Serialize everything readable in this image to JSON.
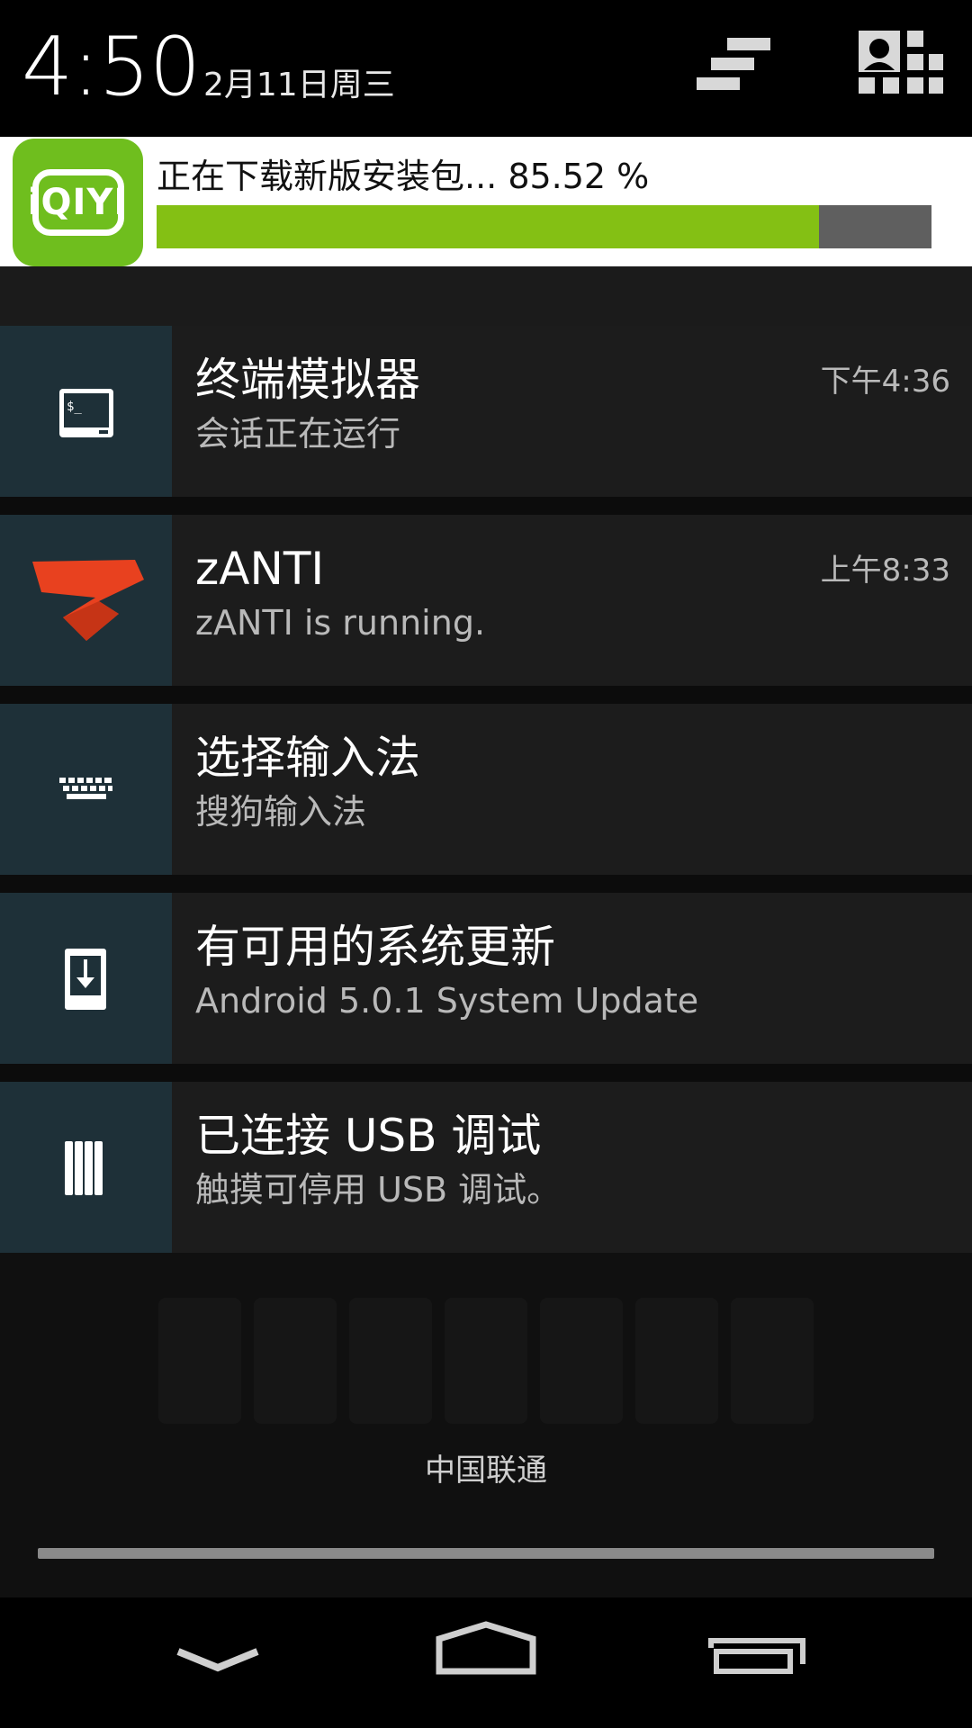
{
  "header": {
    "time": "4:50",
    "date": "2月11日周三"
  },
  "download": {
    "app_icon": "iqiyi-app-icon",
    "icon_text": "iQIYI",
    "text": "正在下载新版安装包... 85.52 %",
    "progress_percent": 85.52
  },
  "notifications": [
    {
      "title": "终端模拟器",
      "subtitle": "会话正在运行",
      "time": "下午4:36",
      "icon": "terminal-icon"
    },
    {
      "title": "zANTI",
      "subtitle": "zANTI is running.",
      "time": "上午8:33",
      "icon": "zanti-icon"
    },
    {
      "title": "选择输入法",
      "subtitle": "搜狗输入法",
      "time": "",
      "icon": "keyboard-icon"
    },
    {
      "title": "有可用的系统更新",
      "subtitle": "Android 5.0.1 System Update",
      "time": "",
      "icon": "system-update-icon"
    },
    {
      "title": "已连接 USB 调试",
      "subtitle": "触摸可停用 USB 调试。",
      "time": "",
      "icon": "usb-debug-icon"
    }
  ],
  "carrier": "中国联通",
  "colors": {
    "accent_green": "#84C014",
    "icon_bg": "#1E3038",
    "zanti_red": "#E8411F"
  }
}
